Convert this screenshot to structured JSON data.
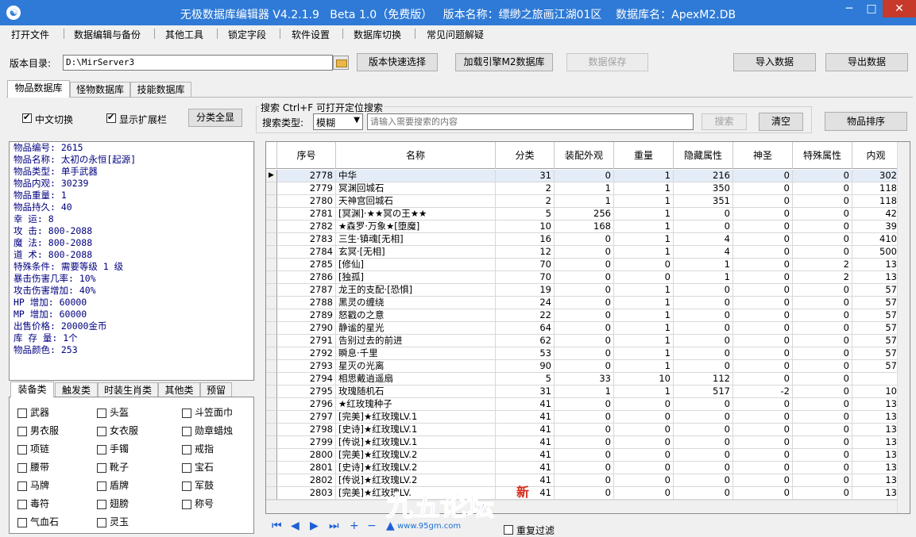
{
  "window": {
    "title": "无极数据库编辑器 V4.2.1.9   Beta 1.0（免费版）   版本名称：缥缈之旅画江湖01区    数据库名：ApexM2.DB",
    "min": "─",
    "max": "□",
    "close": "✕",
    "app_icon": "☯"
  },
  "menu": [
    "打开文件",
    "数据编辑与备份",
    "其他工具",
    "锁定字段",
    "软件设置",
    "数据库切换",
    "常见问题解疑"
  ],
  "toolbar": {
    "dir_label": "版本目录:",
    "dir_value": "D:\\MirServer3",
    "quick_select": "版本快速选择",
    "load_engine": "加载引擎M2数据库",
    "save": "数据保存",
    "import": "导入数据",
    "export": "导出数据"
  },
  "tabs": [
    "物品数据库",
    "怪物数据库",
    "技能数据库"
  ],
  "options": {
    "chinese_toggle": "中文切换",
    "show_ext": "显示扩展栏",
    "show_all_cat": "分类全显"
  },
  "search": {
    "group_title": "搜索   Ctrl+F 可打开定位搜索",
    "type_label": "搜索类型:",
    "type_value": "模糊",
    "placeholder": "请输入需要搜索的内容",
    "search_btn": "搜索",
    "clear_btn": "清空",
    "sort_btn": "物品排序"
  },
  "info_lines": [
    "物品编号: 2615",
    "物品名称: 太初の永恒[起源]",
    "物品类型: 单手武器",
    "物品内观: 30239",
    "物品重量: 1",
    "物品持久: 40",
    "幸    运: 8",
    "攻    击: 800-2088",
    "魔    法: 800-2088",
    "道    术: 800-2088",
    "特殊条件: 需要等级 1 级",
    "暴击伤害几率: 10%",
    "攻击伤害增加: 40%",
    "HP  增加: 60000",
    "MP  增加: 60000",
    "出售价格: 20000金币",
    "库 存 量: 1个",
    "物品颜色: 253"
  ],
  "cat_tabs": [
    "装备类",
    "触发类",
    "时装生肖类",
    "其他类",
    "预留"
  ],
  "categories": [
    [
      "武器",
      "头盔",
      "斗笠面巾"
    ],
    [
      "男衣服",
      "女衣服",
      "勋章蜡烛"
    ],
    [
      "项链",
      "手镯",
      "戒指"
    ],
    [
      "腰带",
      "靴子",
      "宝石"
    ],
    [
      "马牌",
      "盾牌",
      "军鼓"
    ],
    [
      "毒符",
      "翅膀",
      "称号"
    ],
    [
      "气血石",
      "灵玉",
      ""
    ]
  ],
  "grid": {
    "columns": [
      "序号",
      "名称",
      "分类",
      "装配外观",
      "重量",
      "隐藏属性",
      "神圣",
      "特殊属性",
      "内观"
    ],
    "rows": [
      [
        "2778",
        "中华",
        "31",
        "0",
        "1",
        "216",
        "0",
        "0",
        "302"
      ],
      [
        "2779",
        "冥渊回城石",
        "2",
        "1",
        "1",
        "350",
        "0",
        "0",
        "118"
      ],
      [
        "2780",
        "天神宫回城石",
        "2",
        "1",
        "1",
        "351",
        "0",
        "0",
        "118"
      ],
      [
        "2781",
        "[冥渊]·★★冥の王★★",
        "5",
        "256",
        "1",
        "0",
        "0",
        "0",
        "42"
      ],
      [
        "2782",
        "★森罗·万象★[堕魔]",
        "10",
        "168",
        "1",
        "0",
        "0",
        "0",
        "39"
      ],
      [
        "2783",
        "三生·镇魂[无相]",
        "16",
        "0",
        "1",
        "4",
        "0",
        "0",
        "410"
      ],
      [
        "2784",
        "玄冥·[无相]",
        "12",
        "0",
        "1",
        "4",
        "0",
        "0",
        "500"
      ],
      [
        "2785",
        "[修仙]",
        "70",
        "0",
        "0",
        "1",
        "0",
        "2",
        "13"
      ],
      [
        "2786",
        "[独孤]",
        "70",
        "0",
        "0",
        "1",
        "0",
        "2",
        "13"
      ],
      [
        "2787",
        "龙王的支配·[恐惧]",
        "19",
        "0",
        "1",
        "0",
        "0",
        "0",
        "57"
      ],
      [
        "2788",
        "黑灵の缠绕",
        "24",
        "0",
        "1",
        "0",
        "0",
        "0",
        "57"
      ],
      [
        "2789",
        "怒戳の之意",
        "22",
        "0",
        "1",
        "0",
        "0",
        "0",
        "57"
      ],
      [
        "2790",
        "静谧的星光",
        "64",
        "0",
        "1",
        "0",
        "0",
        "0",
        "57"
      ],
      [
        "2791",
        "告别过去的前进",
        "62",
        "0",
        "1",
        "0",
        "0",
        "0",
        "57"
      ],
      [
        "2792",
        "瞬息·千里",
        "53",
        "0",
        "1",
        "0",
        "0",
        "0",
        "57"
      ],
      [
        "2793",
        "星灭の光离",
        "90",
        "0",
        "1",
        "0",
        "0",
        "0",
        "57"
      ],
      [
        "2794",
        "相思戴逍遥扇",
        "5",
        "33",
        "10",
        "112",
        "0",
        "0",
        ""
      ],
      [
        "2795",
        "玫瑰随机石",
        "31",
        "1",
        "1",
        "517",
        "-2",
        "0",
        "10"
      ],
      [
        "2796",
        "★红玫瑰种子",
        "41",
        "0",
        "0",
        "0",
        "0",
        "0",
        "13"
      ],
      [
        "2797",
        "[完美]★红玫瑰LV.1",
        "41",
        "0",
        "0",
        "0",
        "0",
        "0",
        "13"
      ],
      [
        "2798",
        "[史诗]★红玫瑰LV.1",
        "41",
        "0",
        "0",
        "0",
        "0",
        "0",
        "13"
      ],
      [
        "2799",
        "[传说]★红玫瑰LV.1",
        "41",
        "0",
        "0",
        "0",
        "0",
        "0",
        "13"
      ],
      [
        "2800",
        "[完美]★红玫瑰LV.2",
        "41",
        "0",
        "0",
        "0",
        "0",
        "0",
        "13"
      ],
      [
        "2801",
        "[史诗]★红玫瑰LV.2",
        "41",
        "0",
        "0",
        "0",
        "0",
        "0",
        "13"
      ],
      [
        "2802",
        "[传说]★红玫瑰LV.2",
        "41",
        "0",
        "0",
        "0",
        "0",
        "0",
        "13"
      ],
      [
        "2803",
        "[完美]★红玫瑰LV.",
        "41",
        "0",
        "0",
        "0",
        "0",
        "0",
        "13"
      ]
    ]
  },
  "nav": {
    "first": "⏮",
    "prev": "◀",
    "next": "▶",
    "last": "⏭",
    "add": "+",
    "del": "−",
    "up": "▲",
    "repeat_filter": "重复过滤"
  },
  "watermark": {
    "main": "九五论坛",
    "sub": "www.95gm.com",
    "badge": "新"
  }
}
